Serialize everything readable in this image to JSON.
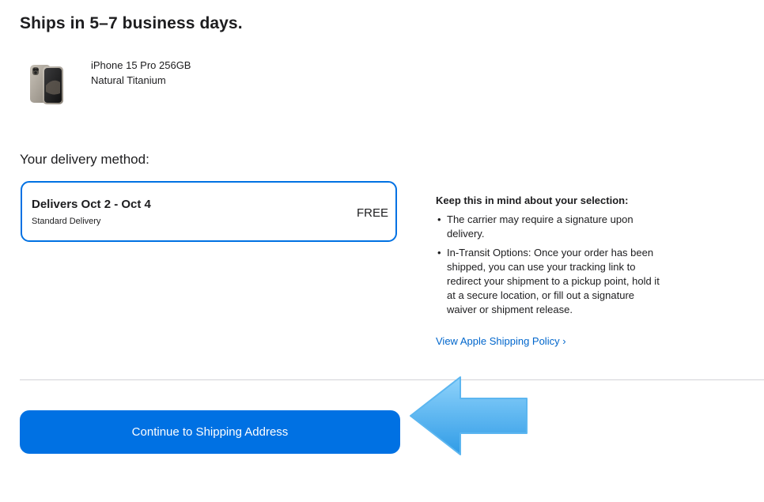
{
  "shipping": {
    "title": "Ships in 5–7 business days."
  },
  "product": {
    "name": "iPhone 15 Pro 256GB",
    "color": "Natural Titanium",
    "image_icon": "iphone-titanium-thumbnail"
  },
  "delivery": {
    "label": "Your delivery method:",
    "option": {
      "title": "Delivers Oct 2 - Oct 4",
      "subtitle": "Standard Delivery",
      "price": "FREE",
      "selected": true
    }
  },
  "info": {
    "title": "Keep this in mind about your selection:",
    "bullets": [
      "The carrier may require a signature upon delivery.",
      "In-Transit Options: Once your order has been shipped, you can use your tracking link to redirect your shipment to a pickup point, hold it at a secure location, or fill out a signature waiver or shipment release."
    ],
    "link": "View Apple Shipping Policy ›"
  },
  "actions": {
    "continue_label": "Continue to Shipping Address"
  },
  "annotation": {
    "icon": "blue-pointer-arrow-icon",
    "color": "#4fb3ef"
  },
  "colors": {
    "accent": "#0071e3",
    "link": "#0066cc",
    "text": "#1d1d1f",
    "divider": "#d2d2d7"
  }
}
